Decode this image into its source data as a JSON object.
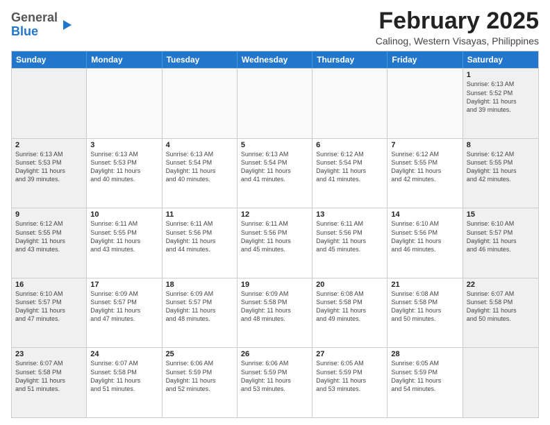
{
  "logo": {
    "general": "General",
    "blue": "Blue"
  },
  "header": {
    "month": "February 2025",
    "location": "Calinog, Western Visayas, Philippines"
  },
  "weekdays": [
    "Sunday",
    "Monday",
    "Tuesday",
    "Wednesday",
    "Thursday",
    "Friday",
    "Saturday"
  ],
  "rows": [
    [
      {
        "day": "",
        "info": ""
      },
      {
        "day": "",
        "info": ""
      },
      {
        "day": "",
        "info": ""
      },
      {
        "day": "",
        "info": ""
      },
      {
        "day": "",
        "info": ""
      },
      {
        "day": "",
        "info": ""
      },
      {
        "day": "1",
        "info": "Sunrise: 6:13 AM\nSunset: 5:52 PM\nDaylight: 11 hours\nand 39 minutes."
      }
    ],
    [
      {
        "day": "2",
        "info": "Sunrise: 6:13 AM\nSunset: 5:53 PM\nDaylight: 11 hours\nand 39 minutes."
      },
      {
        "day": "3",
        "info": "Sunrise: 6:13 AM\nSunset: 5:53 PM\nDaylight: 11 hours\nand 40 minutes."
      },
      {
        "day": "4",
        "info": "Sunrise: 6:13 AM\nSunset: 5:54 PM\nDaylight: 11 hours\nand 40 minutes."
      },
      {
        "day": "5",
        "info": "Sunrise: 6:13 AM\nSunset: 5:54 PM\nDaylight: 11 hours\nand 41 minutes."
      },
      {
        "day": "6",
        "info": "Sunrise: 6:12 AM\nSunset: 5:54 PM\nDaylight: 11 hours\nand 41 minutes."
      },
      {
        "day": "7",
        "info": "Sunrise: 6:12 AM\nSunset: 5:55 PM\nDaylight: 11 hours\nand 42 minutes."
      },
      {
        "day": "8",
        "info": "Sunrise: 6:12 AM\nSunset: 5:55 PM\nDaylight: 11 hours\nand 42 minutes."
      }
    ],
    [
      {
        "day": "9",
        "info": "Sunrise: 6:12 AM\nSunset: 5:55 PM\nDaylight: 11 hours\nand 43 minutes."
      },
      {
        "day": "10",
        "info": "Sunrise: 6:11 AM\nSunset: 5:55 PM\nDaylight: 11 hours\nand 43 minutes."
      },
      {
        "day": "11",
        "info": "Sunrise: 6:11 AM\nSunset: 5:56 PM\nDaylight: 11 hours\nand 44 minutes."
      },
      {
        "day": "12",
        "info": "Sunrise: 6:11 AM\nSunset: 5:56 PM\nDaylight: 11 hours\nand 45 minutes."
      },
      {
        "day": "13",
        "info": "Sunrise: 6:11 AM\nSunset: 5:56 PM\nDaylight: 11 hours\nand 45 minutes."
      },
      {
        "day": "14",
        "info": "Sunrise: 6:10 AM\nSunset: 5:56 PM\nDaylight: 11 hours\nand 46 minutes."
      },
      {
        "day": "15",
        "info": "Sunrise: 6:10 AM\nSunset: 5:57 PM\nDaylight: 11 hours\nand 46 minutes."
      }
    ],
    [
      {
        "day": "16",
        "info": "Sunrise: 6:10 AM\nSunset: 5:57 PM\nDaylight: 11 hours\nand 47 minutes."
      },
      {
        "day": "17",
        "info": "Sunrise: 6:09 AM\nSunset: 5:57 PM\nDaylight: 11 hours\nand 47 minutes."
      },
      {
        "day": "18",
        "info": "Sunrise: 6:09 AM\nSunset: 5:57 PM\nDaylight: 11 hours\nand 48 minutes."
      },
      {
        "day": "19",
        "info": "Sunrise: 6:09 AM\nSunset: 5:58 PM\nDaylight: 11 hours\nand 48 minutes."
      },
      {
        "day": "20",
        "info": "Sunrise: 6:08 AM\nSunset: 5:58 PM\nDaylight: 11 hours\nand 49 minutes."
      },
      {
        "day": "21",
        "info": "Sunrise: 6:08 AM\nSunset: 5:58 PM\nDaylight: 11 hours\nand 50 minutes."
      },
      {
        "day": "22",
        "info": "Sunrise: 6:07 AM\nSunset: 5:58 PM\nDaylight: 11 hours\nand 50 minutes."
      }
    ],
    [
      {
        "day": "23",
        "info": "Sunrise: 6:07 AM\nSunset: 5:58 PM\nDaylight: 11 hours\nand 51 minutes."
      },
      {
        "day": "24",
        "info": "Sunrise: 6:07 AM\nSunset: 5:58 PM\nDaylight: 11 hours\nand 51 minutes."
      },
      {
        "day": "25",
        "info": "Sunrise: 6:06 AM\nSunset: 5:59 PM\nDaylight: 11 hours\nand 52 minutes."
      },
      {
        "day": "26",
        "info": "Sunrise: 6:06 AM\nSunset: 5:59 PM\nDaylight: 11 hours\nand 53 minutes."
      },
      {
        "day": "27",
        "info": "Sunrise: 6:05 AM\nSunset: 5:59 PM\nDaylight: 11 hours\nand 53 minutes."
      },
      {
        "day": "28",
        "info": "Sunrise: 6:05 AM\nSunset: 5:59 PM\nDaylight: 11 hours\nand 54 minutes."
      },
      {
        "day": "",
        "info": ""
      }
    ]
  ]
}
